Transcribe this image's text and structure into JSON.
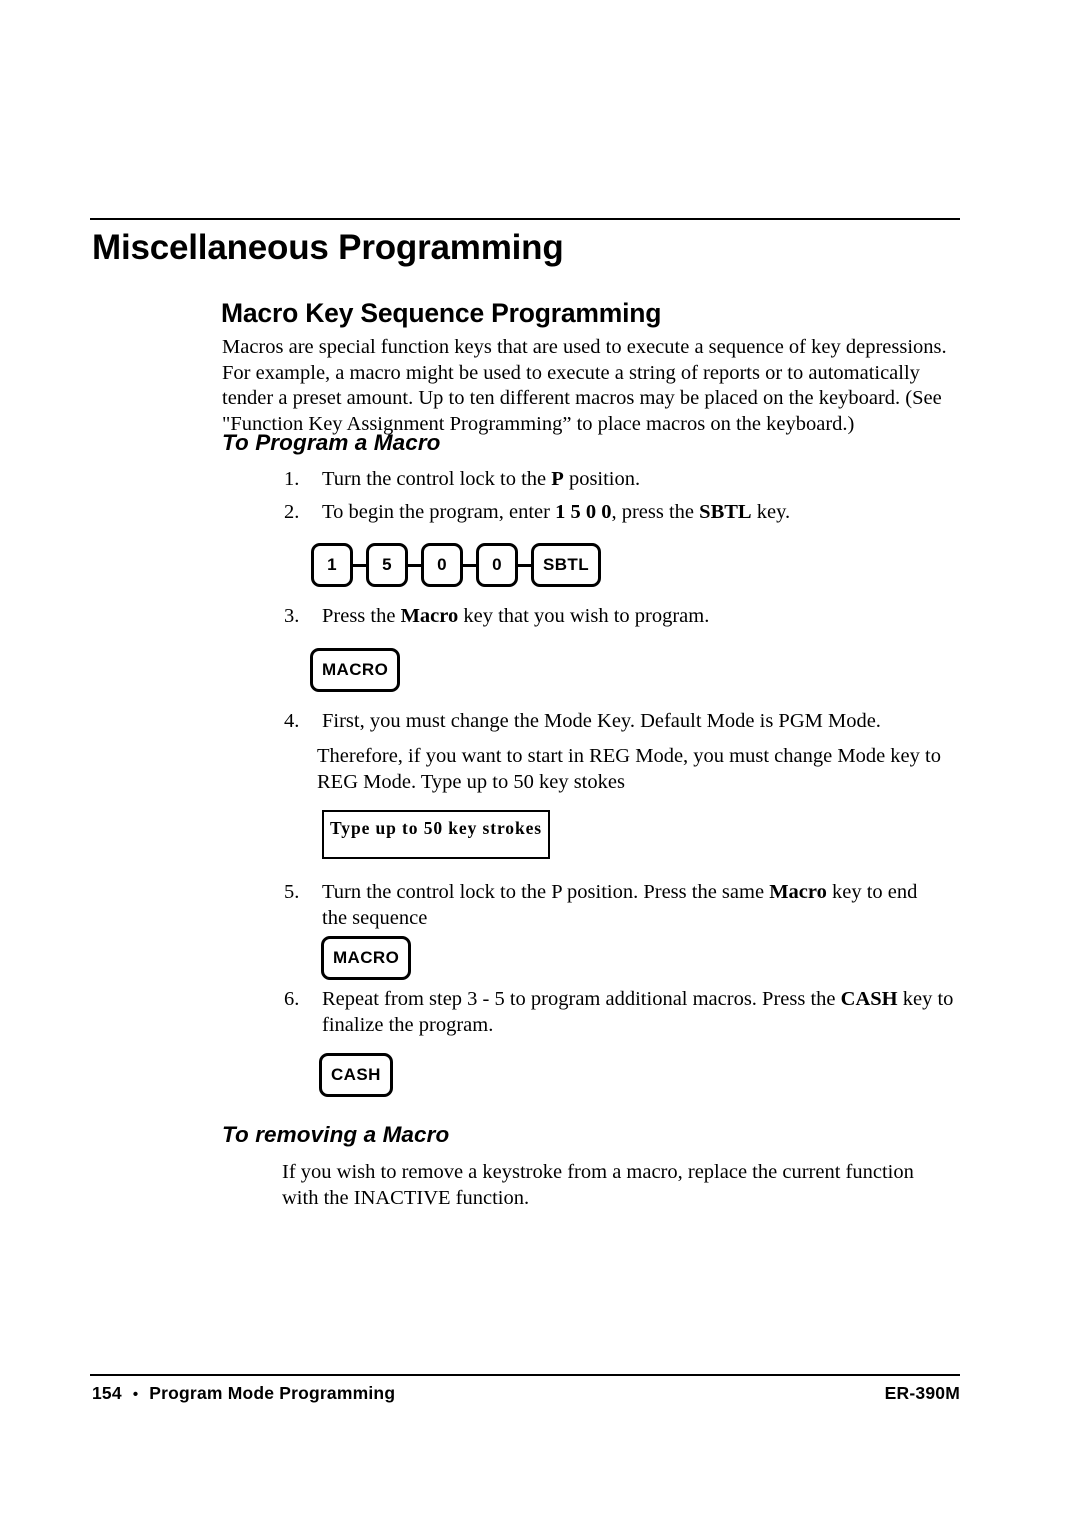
{
  "document": {
    "chapter_title": "Miscellaneous Programming",
    "section_heading": "Macro Key Sequence Programming",
    "intro_paragraph": "Macros are special function keys that are used to execute a sequence of key depressions.   For example, a macro might be used to execute a string of reports or to automatically tender a preset amount. Up to ten different macros may be placed on the keyboard.   (See \"Function Key Assignment Programming” to place macros on the keyboard.)"
  },
  "to_program_a_macro": {
    "heading": "To Program a Macro",
    "steps": [
      {
        "number": "1.",
        "text_before": "Turn the control lock to the ",
        "bold": "P",
        "text_after": " position."
      },
      {
        "number": "2.",
        "text_before": "To begin the program, enter ",
        "bold": "1 5 0 0",
        "text_mid": ", press the ",
        "bold2": "SBTL",
        "text_after": " key."
      },
      {
        "number": "3.",
        "text_before": "Press the ",
        "bold": "Macro",
        "text_after": " key that you wish to program."
      },
      {
        "number": "4.",
        "text_before": "First, you must change the Mode Key. Default Mode is PGM Mode.",
        "continuation": "Therefore, if you want to start in REG Mode, you must change Mode key to REG Mode. Type up to 50 key stokes"
      },
      {
        "number": "5.",
        "text_before": "Turn the control lock to the P position. Press the same ",
        "bold": "Macro",
        "text_after": " key to end the sequence"
      },
      {
        "number": "6.",
        "text_before": "Repeat from step 3 - 5 to program additional macros.    Press the ",
        "bold": "CASH",
        "text_after": " key to finalize the program."
      }
    ]
  },
  "key_sequence": {
    "keys": [
      "1",
      "5",
      "0",
      "0",
      "SBTL"
    ],
    "macro_key_1": "MACRO",
    "macro_key_2": "MACRO",
    "cash_key": "CASH",
    "type_box_label": "Type up to 50  key strokes"
  },
  "to_removing_a_macro": {
    "heading": "To removing a Macro",
    "body": "If you wish to remove a keystroke from a macro, replace the current function with the INACTIVE function."
  },
  "footer": {
    "page_number": "154",
    "bullet": "•",
    "section_label": "Program Mode Programming",
    "model": "ER-390M"
  }
}
